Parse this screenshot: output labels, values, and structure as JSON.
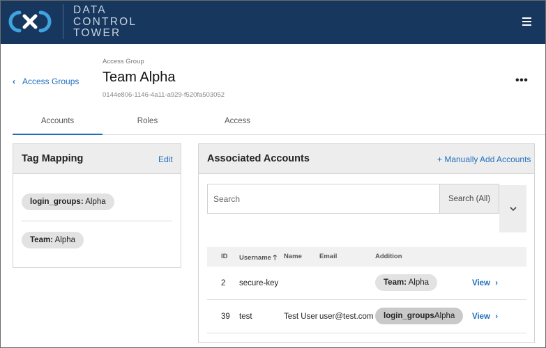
{
  "brand": {
    "lines": [
      "DATA",
      "CONTROL",
      "TOWER"
    ],
    "navy": "#17375e",
    "logo_color": "#3fa3e0"
  },
  "header": {
    "back_label": "Access Groups",
    "eyebrow": "Access Group",
    "title": "Team Alpha",
    "id": "0144e806-1146-4a11-a929-f520fa503052",
    "more_label": "•••"
  },
  "tabs": [
    {
      "label": "Accounts",
      "active": true
    },
    {
      "label": "Roles",
      "active": false
    },
    {
      "label": "Access",
      "active": false
    }
  ],
  "tag_mapping": {
    "title": "Tag Mapping",
    "edit_label": "Edit",
    "tags": [
      {
        "key": "login_groups:",
        "value": " Alpha"
      },
      {
        "key": "Team:",
        "value": " Alpha"
      }
    ]
  },
  "accounts": {
    "title": "Associated Accounts",
    "add_label": "+ Manually Add Accounts",
    "search_placeholder": "Search",
    "search_filter": "Search (All)",
    "columns": {
      "id": "ID",
      "username": "Username",
      "name": "Name",
      "email": "Email",
      "addition": "Addition"
    },
    "rows": [
      {
        "id": "2",
        "username": "secure-key",
        "name": "",
        "email": "",
        "tag_key": "Team:",
        "tag_value": " Alpha",
        "action": "View"
      },
      {
        "id": "39",
        "username": "test",
        "name": "Test User",
        "email": "user@test.com",
        "tag_key": "login_groups",
        "tag_value": "Alpha",
        "action": "View"
      }
    ]
  },
  "accent": "#1f6fbf"
}
